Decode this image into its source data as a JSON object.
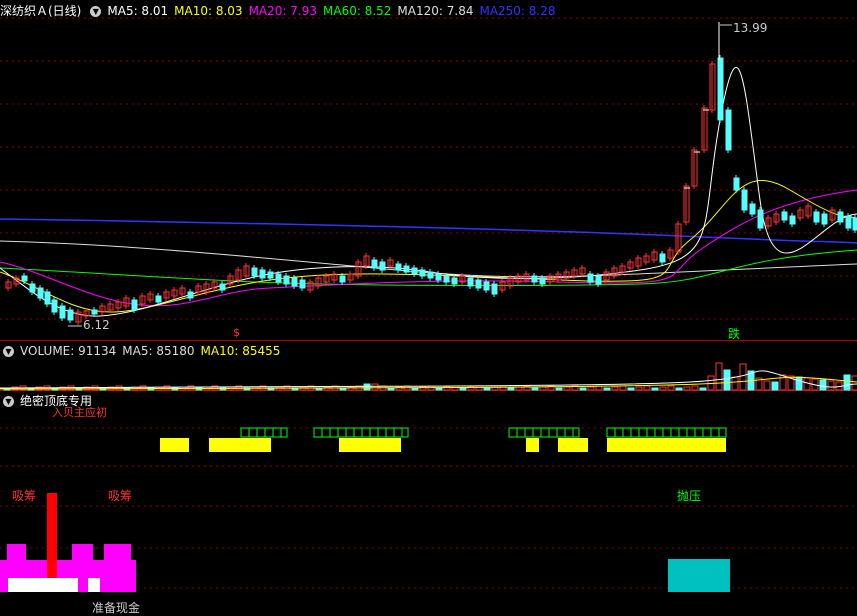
{
  "main_panel": {
    "title": "深纺织Ａ(日线)",
    "indicators": [
      {
        "label": "MA5: 8.01",
        "color": "#ffffff"
      },
      {
        "label": "MA10: 8.03",
        "color": "#ffff00"
      },
      {
        "label": "MA20: 7.93",
        "color": "#ff00ff"
      },
      {
        "label": "MA60: 8.52",
        "color": "#00ff00"
      },
      {
        "label": "MA120: 7.84",
        "color": "#dddddd"
      },
      {
        "label": "MA250: 8.28",
        "color": "#3333ff"
      }
    ],
    "high_label": "13.99",
    "low_label": "6.12",
    "marker_rise": "$",
    "marker_fall": "跌"
  },
  "volume_panel": {
    "indicators": [
      {
        "label": "VOLUME: 91134",
        "color": "#dddddd"
      },
      {
        "label": "MA5: 85180",
        "color": "#dddddd"
      },
      {
        "label": "MA10: 85455",
        "color": "#ffff00"
      }
    ]
  },
  "signal_panel": {
    "title": "绝密顶底专用",
    "partial_label": "入贝主应初",
    "absorb_label_1": "吸筹",
    "absorb_label_2": "吸筹",
    "pressure_label": "抛压",
    "cash_label": "准备现金"
  },
  "colors": {
    "up": "#ff3232",
    "down": "#54ffff",
    "grid": "#8b0000",
    "yellow": "#ffff00",
    "green": "#00ff00",
    "magenta": "#ff00ff",
    "cyan": "#00c0c0"
  }
}
